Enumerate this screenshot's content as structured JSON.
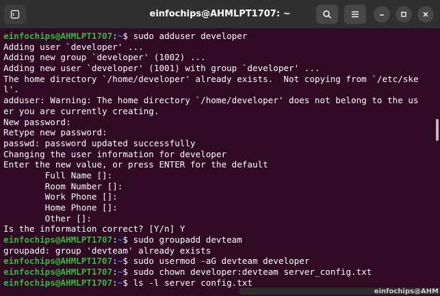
{
  "window": {
    "title": "einfochips@AHMLPT1707: ~",
    "background_color": "#300a24",
    "titlebar_color": "#303030"
  },
  "titlebar": {
    "icons": [
      "new-tab-icon",
      "search-icon",
      "hamburger-menu-icon",
      "minimize-icon",
      "maximize-icon",
      "close-icon"
    ]
  },
  "prompt": {
    "user_host": "einfochips@AHMLPT1707",
    "path": "~",
    "user_color": "#2ebd3a",
    "path_color": "#2f72ff"
  },
  "terminal": {
    "lines": [
      {
        "type": "prompt",
        "user": "einfochips@AHMLPT1707",
        "sep": ":",
        "path": "~",
        "cmd": "$ sudo adduser developer"
      },
      {
        "type": "output",
        "text": "Adding user `developer' ..."
      },
      {
        "type": "output",
        "text": "Adding new group `developer' (1002) ..."
      },
      {
        "type": "output",
        "text": "Adding new user `developer' (1001) with group `developer' ..."
      },
      {
        "type": "output",
        "text": "The home directory `/home/developer' already exists.  Not copying from `/etc/ske"
      },
      {
        "type": "output",
        "text": "l'."
      },
      {
        "type": "output",
        "text": "adduser: Warning: The home directory `/home/developer' does not belong to the us"
      },
      {
        "type": "output",
        "text": "er you are currently creating."
      },
      {
        "type": "output",
        "text": "New password:"
      },
      {
        "type": "output",
        "text": "Retype new password:"
      },
      {
        "type": "output",
        "text": "passwd: password updated successfully"
      },
      {
        "type": "output",
        "text": "Changing the user information for developer"
      },
      {
        "type": "output",
        "text": "Enter the new value, or press ENTER for the default"
      },
      {
        "type": "output",
        "text": "        Full Name []:"
      },
      {
        "type": "output",
        "text": "        Room Number []:"
      },
      {
        "type": "output",
        "text": "        Work Phone []:"
      },
      {
        "type": "output",
        "text": "        Home Phone []:"
      },
      {
        "type": "output",
        "text": "        Other []:"
      },
      {
        "type": "output",
        "text": "Is the information correct? [Y/n] Y"
      },
      {
        "type": "prompt",
        "user": "einfochips@AHMLPT1707",
        "sep": ":",
        "path": "~",
        "cmd": "$ sudo groupadd devteam"
      },
      {
        "type": "output",
        "text": "groupadd: group 'devteam' already exists"
      },
      {
        "type": "prompt",
        "user": "einfochips@AHMLPT1707",
        "sep": ":",
        "path": "~",
        "cmd": "$ sudo usermod -aG devteam developer"
      },
      {
        "type": "prompt",
        "user": "einfochips@AHMLPT1707",
        "sep": ":",
        "path": "~",
        "cmd": "$ sudo chown developer:devteam server_config.txt"
      },
      {
        "type": "prompt",
        "user": "einfochips@AHMLPT1707",
        "sep": ":",
        "path": "~",
        "cmd": "$ ls -l server config.txt"
      }
    ]
  },
  "background_window": {
    "title": "einfochips@AHM"
  }
}
